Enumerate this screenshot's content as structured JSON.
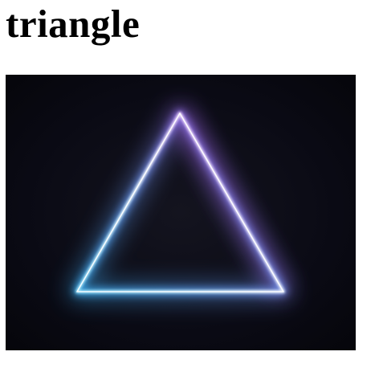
{
  "page": {
    "title": "triangle"
  },
  "image": {
    "description_icon": "neon-triangle-icon",
    "colors": {
      "background_dark": "#06060d",
      "glow_blue": "#5fd6ff",
      "glow_purple": "#d66bff",
      "core_white": "#ffffff"
    }
  }
}
